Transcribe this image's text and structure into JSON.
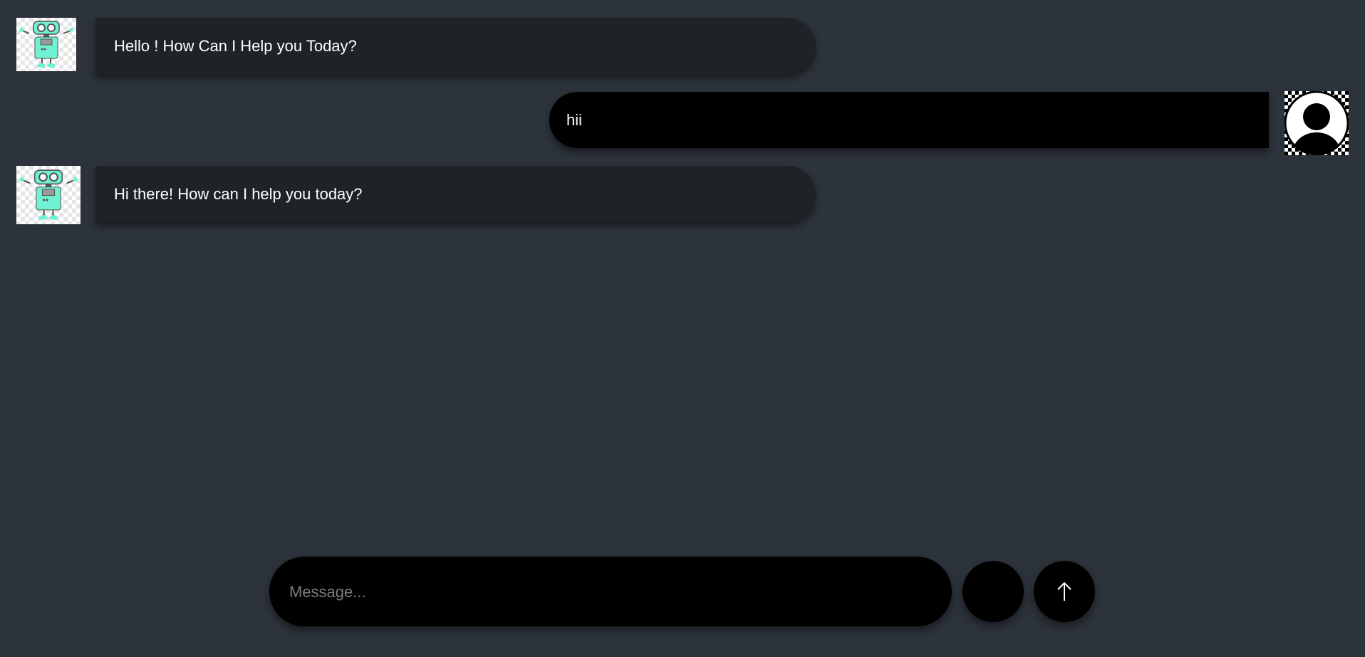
{
  "messages": [
    {
      "sender": "bot",
      "text": "Hello ! How Can I Help you Today?",
      "avatar_icon": "robot-icon"
    },
    {
      "sender": "user",
      "text": "hii",
      "avatar_icon": "user-silhouette-icon"
    },
    {
      "sender": "bot",
      "text": "Hi there! How can I help you today?",
      "avatar_icon": "robot-icon"
    }
  ],
  "composer": {
    "placeholder": "Message...",
    "value": "",
    "secondary_button_icon": "blank-button",
    "send_icon": "arrow-up-icon"
  },
  "colors": {
    "background": "#2d333b",
    "bot_bubble": "#1f2328",
    "user_bubble": "#000000",
    "robot_body": "#6ff2d2"
  }
}
